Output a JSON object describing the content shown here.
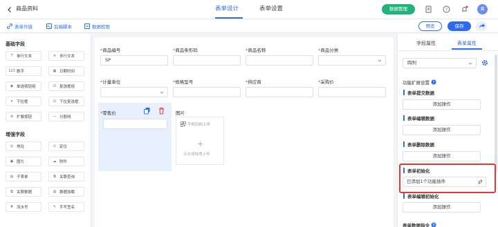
{
  "header": {
    "app_name": "商品资料",
    "tabs": [
      "表单设计",
      "表单设置"
    ],
    "data_manage_btn": "数据管理",
    "avatar_text": "曾"
  },
  "toolbar": {
    "items": [
      "表单外链",
      "后端脚本",
      "数据权限"
    ],
    "preview": "预览",
    "save": "保存"
  },
  "left_panel": {
    "basic_title": "基础字段",
    "basic_fields": [
      {
        "label": "单行文本",
        "icon": "T"
      },
      {
        "label": "多行文本",
        "icon": "≡"
      },
      {
        "label": "数字",
        "icon": "123"
      },
      {
        "label": "日期时间",
        "icon": "▦"
      },
      {
        "label": "单选按钮组",
        "icon": "◉"
      },
      {
        "label": "复选框组",
        "icon": "☑"
      },
      {
        "label": "下拉框",
        "icon": "▾"
      },
      {
        "label": "下拉复选框",
        "icon": "☑"
      },
      {
        "label": "扩展按钮",
        "icon": "⊕"
      },
      {
        "label": "分割线",
        "icon": "—"
      }
    ],
    "enhanced_title": "增强字段",
    "enhanced_fields": [
      {
        "label": "地址",
        "icon": "◎"
      },
      {
        "label": "定位",
        "icon": "⊙"
      },
      {
        "label": "图片",
        "icon": "▣"
      },
      {
        "label": "附件",
        "icon": "☁"
      },
      {
        "label": "子表单",
        "icon": "▤"
      },
      {
        "label": "关联查询",
        "icon": "⧉"
      },
      {
        "label": "关联数据",
        "icon": "⧉"
      },
      {
        "label": "数据加载",
        "icon": "▥"
      },
      {
        "label": "流水号",
        "icon": "#"
      },
      {
        "label": "手写签名",
        "icon": "✎"
      }
    ]
  },
  "canvas": {
    "row1": [
      {
        "label": "商品编号",
        "required": true,
        "value": "SP",
        "type": "text"
      },
      {
        "label": "商品条形码",
        "required": true,
        "value": "",
        "type": "text"
      },
      {
        "label": "商品名称",
        "required": true,
        "value": "",
        "type": "text"
      },
      {
        "label": "商品分类",
        "required": true,
        "value": "",
        "type": "select"
      }
    ],
    "row2": [
      {
        "label": "计量单位",
        "required": true,
        "value": "",
        "type": "select"
      },
      {
        "label": "规格型号",
        "required": true,
        "value": "",
        "type": "text"
      },
      {
        "label": "供应商",
        "required": true,
        "value": "",
        "type": "text"
      },
      {
        "label": "采购价",
        "required": true,
        "value": "",
        "type": "text"
      }
    ],
    "price_label": "零售价",
    "image_label": "图片",
    "upload_phone": "手机扫码上传",
    "upload_click": "点击或拖拽上传"
  },
  "right_panel": {
    "tabs": [
      "字段属性",
      "表单属性"
    ],
    "layout_select": "四列",
    "ext_title": "功能扩展设置",
    "sections": [
      {
        "title": "表单提交数据",
        "button": "添加操作"
      },
      {
        "title": "表单编辑数据",
        "button": "添加操作"
      },
      {
        "title": "表单删除数据",
        "button": "添加操作"
      },
      {
        "title": "表单初始化",
        "button": "已添加1个功能插件"
      },
      {
        "title": "表单编辑初始化",
        "button": "添加操作"
      }
    ],
    "bottom_title": "表单数据指令"
  },
  "colors": {
    "accent": "#2d6cf0",
    "green": "#22b37a",
    "highlight": "#e33333"
  }
}
